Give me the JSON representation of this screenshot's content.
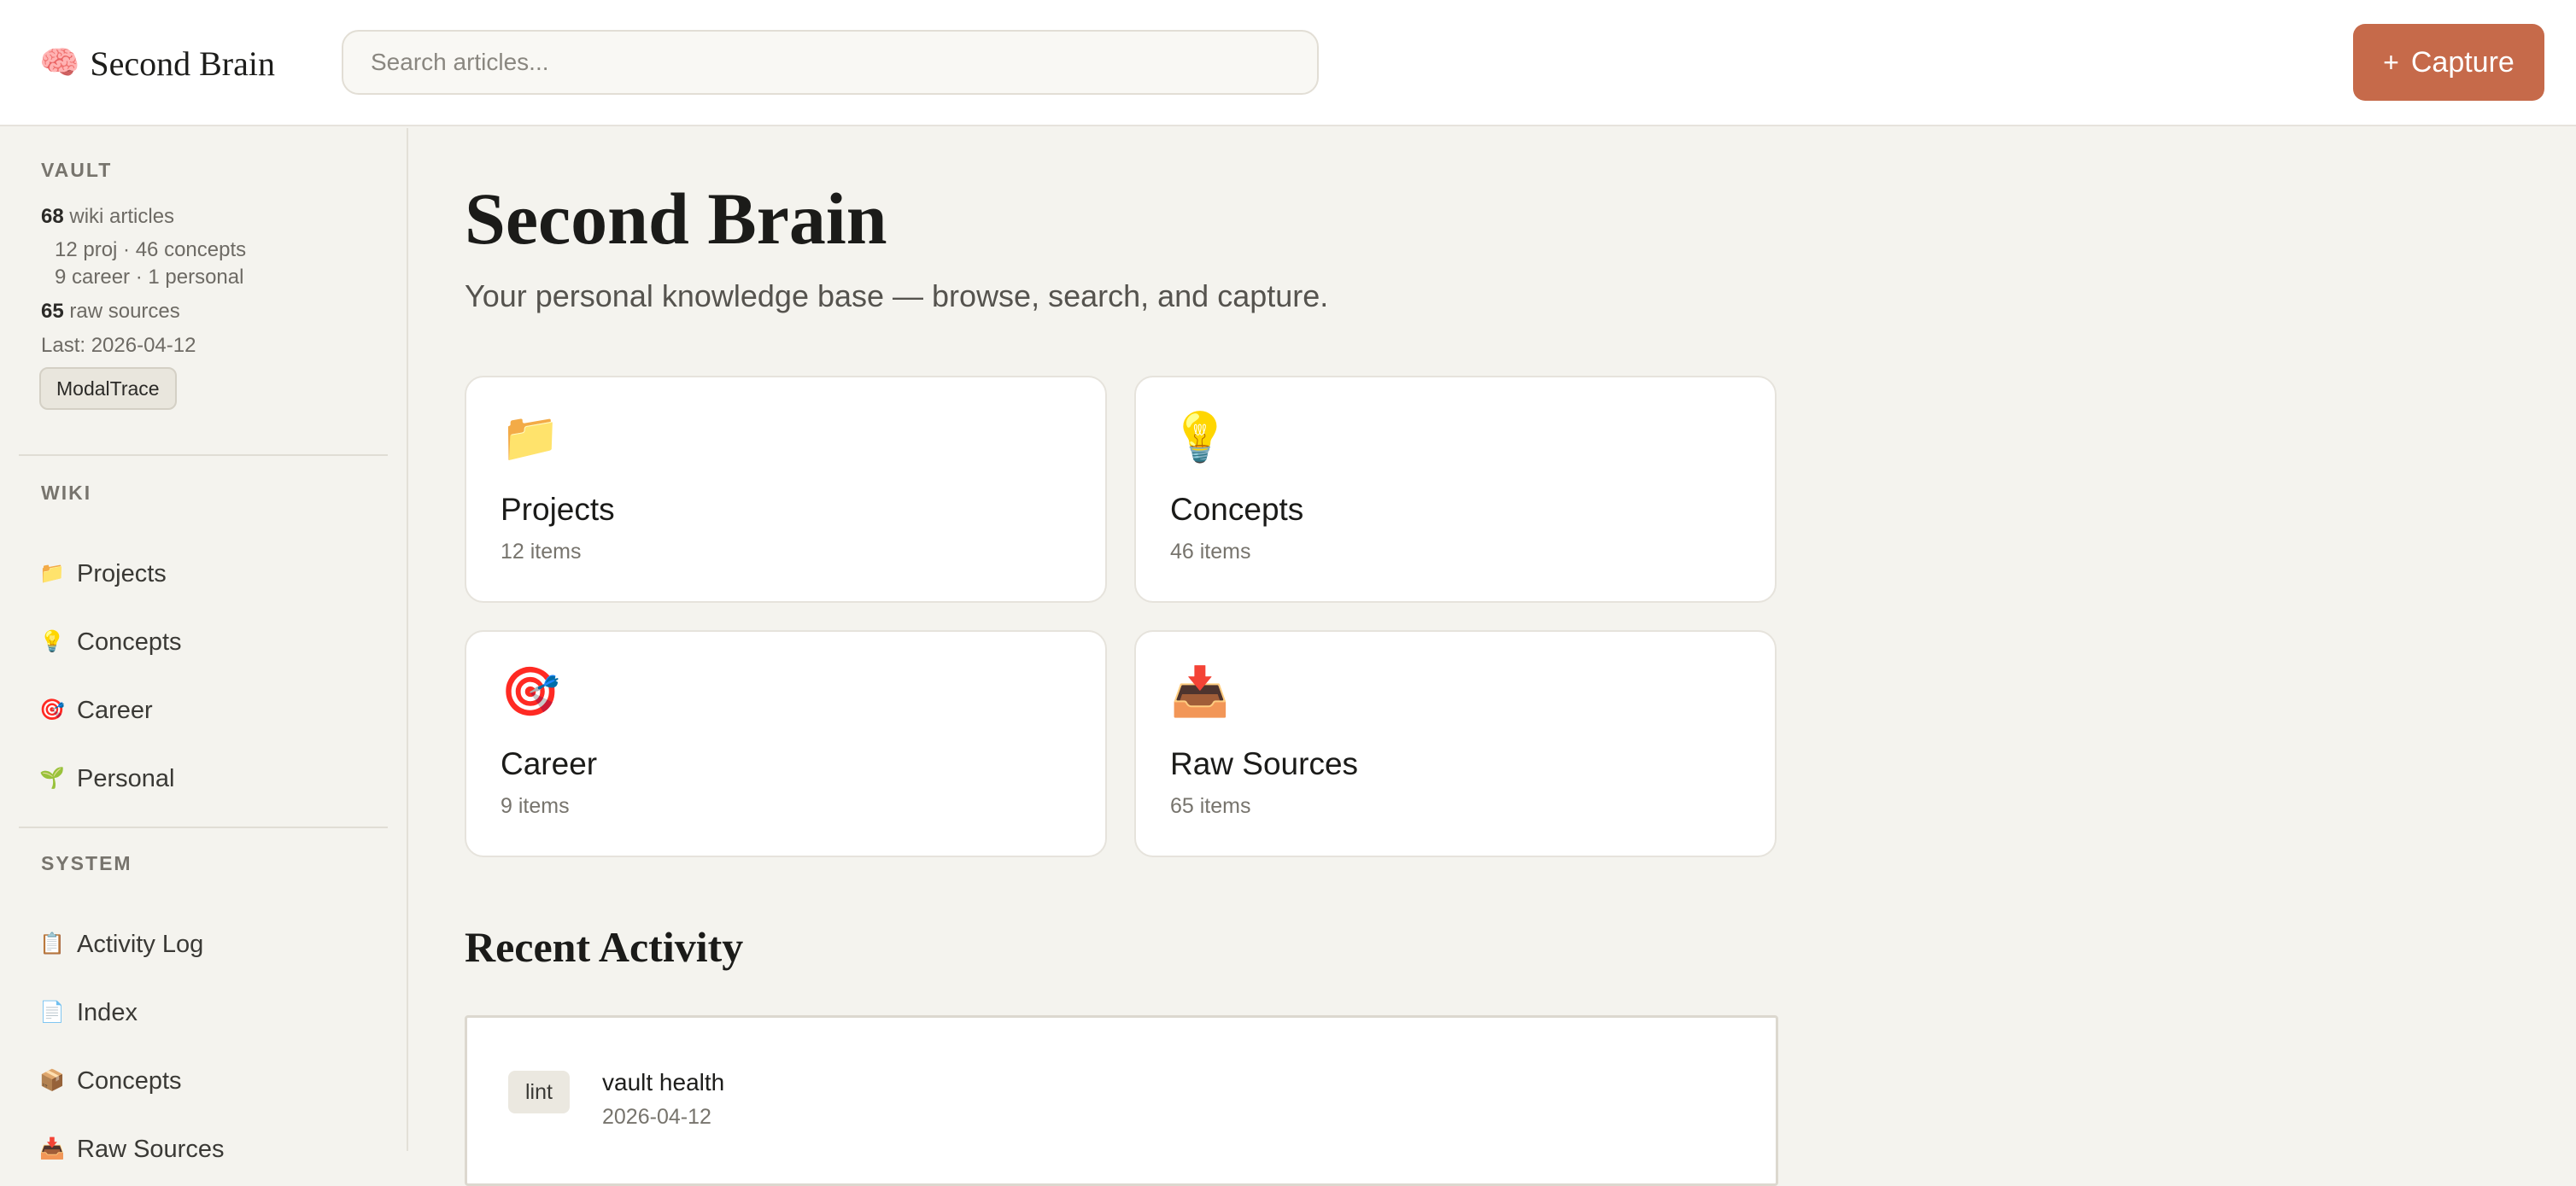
{
  "header": {
    "brand_icon": "🧠",
    "brand_name": "Second Brain",
    "search_placeholder": "Search articles...",
    "capture_plus": "+",
    "capture_label": "Capture",
    "capture_color": "#c66a4a"
  },
  "sidebar": {
    "vault": {
      "title": "VAULT",
      "articles_count": "68",
      "articles_label": "wiki articles",
      "breakdown_1": "12 proj · 46 concepts",
      "breakdown_2": "9 career · 1 personal",
      "sources_count": "65",
      "sources_label": "raw sources",
      "last": "Last: 2026-04-12",
      "badge": "ModalTrace"
    },
    "wiki": {
      "title": "WIKI",
      "items": [
        {
          "icon": "📁",
          "label": "Projects"
        },
        {
          "icon": "💡",
          "label": "Concepts"
        },
        {
          "icon": "🎯",
          "label": "Career"
        },
        {
          "icon": "🌱",
          "label": "Personal"
        }
      ]
    },
    "system": {
      "title": "SYSTEM",
      "items": [
        {
          "icon": "📋",
          "label": "Activity Log"
        },
        {
          "icon": "📄",
          "label": "Index"
        },
        {
          "icon": "📦",
          "label": "Concepts"
        },
        {
          "icon": "📥",
          "label": "Raw Sources"
        }
      ]
    }
  },
  "main": {
    "title": "Second Brain",
    "subtitle": "Your personal knowledge base — browse, search, and capture.",
    "cards": [
      {
        "icon": "📁",
        "title": "Projects",
        "count": "12 items"
      },
      {
        "icon": "💡",
        "title": "Concepts",
        "count": "46 items"
      },
      {
        "icon": "🎯",
        "title": "Career",
        "count": "9 items"
      },
      {
        "icon": "📥",
        "title": "Raw Sources",
        "count": "65 items"
      }
    ],
    "recent_title": "Recent Activity",
    "activity": [
      {
        "tag": "lint",
        "title": "vault health",
        "date": "2026-04-12"
      }
    ]
  }
}
